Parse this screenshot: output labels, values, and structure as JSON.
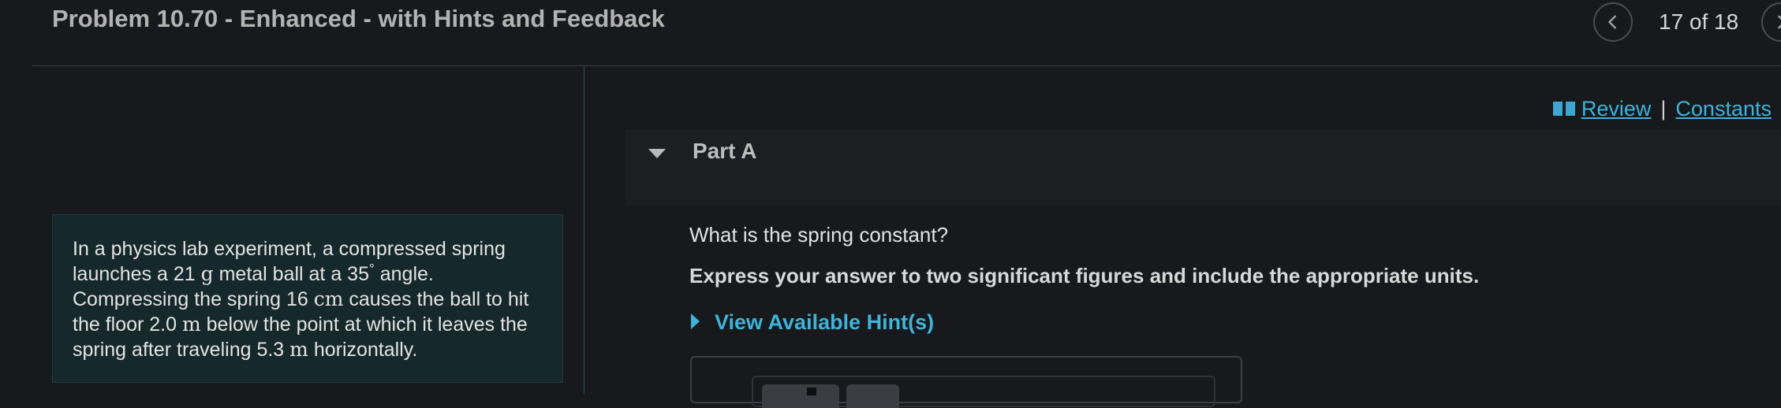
{
  "header": {
    "title": "Problem 10.70 - Enhanced - with Hints and Feedback",
    "counter": "17 of 18",
    "prev_icon": "chevron-left-icon",
    "next_icon": "chevron-right-icon"
  },
  "problem": {
    "segments": [
      "In a physics lab experiment, a compressed spring launches a 21 ",
      "g",
      " metal ball at a 35",
      "°",
      " angle. Compressing the spring 16 ",
      "cm",
      " causes the ball to hit the floor 2.0 ",
      "m",
      " below the point at which it leaves the spring after traveling 5.3 ",
      "m",
      " horizontally."
    ]
  },
  "links": {
    "review": "Review",
    "separator": "|",
    "constants": "Constants",
    "review_icon": "book-icon"
  },
  "part": {
    "label": "Part A",
    "question": "What is the spring constant?",
    "instructions": "Express your answer to two significant figures and include the appropriate units.",
    "hint_label": "View Available Hint(s)"
  },
  "colors": {
    "background": "#17191c",
    "accent": "#3fb3d9",
    "problem_box": "#15282c"
  }
}
